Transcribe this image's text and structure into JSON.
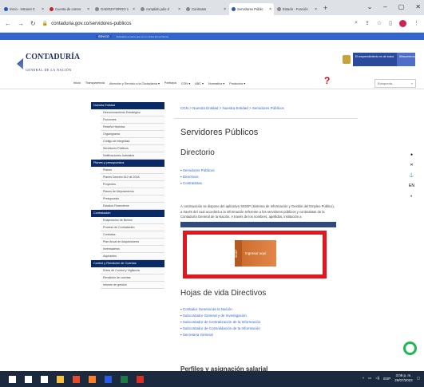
{
  "browser": {
    "tabs": [
      {
        "label": "Inicio - Intranet C",
        "fav": "#2a55b0",
        "active": false
      },
      {
        "label": "Cuenta de correo",
        "fav": "#c5221f",
        "active": false
      },
      {
        "label": "GADOZ-FORGO 1",
        "fav": "#888888",
        "active": false
      },
      {
        "label": "cumplido julio d",
        "fav": "#888888",
        "active": false
      },
      {
        "label": "Contratos",
        "fav": "#888888",
        "active": false
      },
      {
        "label": "Servidores Públic",
        "fav": "#2a55b0",
        "active": true
      },
      {
        "label": "Estado - Función",
        "fav": "#888888",
        "active": false
      }
    ],
    "url": "contaduria.gov.co/servidores-publicos",
    "colors": {
      "tabbar": "#dee1e6"
    }
  },
  "gov_bar": {
    "logo": "GOV.CO",
    "text": "El Estado se tiene que ver en todos los territorios"
  },
  "header": {
    "logo_main": "CONTADURÍA",
    "logo_sub": "GENERAL DE LA NACIÓN",
    "banner_1": "El emprendimiento es de todos",
    "banner_2": "Mincomercio"
  },
  "nav": {
    "items": [
      "Inicio",
      "Transparencia",
      "Atención y Servicio a la Ciudadanía ▾",
      "Participa",
      "CGN ▾",
      "ABC ▾",
      "Normativa ▾",
      "Productos ▾"
    ],
    "question_mark": "?",
    "search_placeholder": "Búsqueda..."
  },
  "sidebar": {
    "sections": [
      {
        "title": "Nuestra Entidad",
        "items": [
          "Direccionamiento Estratégico",
          "Funciones",
          "Reseña Histórica",
          "Organigrama",
          "Código de Integridad",
          "Servidores Públicos",
          "Notificaciones Judiciales"
        ]
      },
      {
        "title": "Planes y presupuestos",
        "items": [
          "Planes",
          "Planes Decreto 612 de 2018",
          "Proyectos",
          "Planes de Mejoramiento",
          "Presupuesto",
          "Estados Financieros"
        ]
      },
      {
        "title": "Contratación",
        "items": [
          "Enajenación de Bienes",
          "Proceso de Contratación",
          "Contratos",
          "Plan Anual de Adquisiciones",
          "Invernaderos",
          "Aspirantes"
        ]
      },
      {
        "title": "Control y Rendición de Cuentas",
        "items": [
          "Entes de Control y Vigilancia",
          "Rendición de cuentas",
          "Informe de gestión"
        ]
      }
    ]
  },
  "content": {
    "breadcrumb": "CGN  >  Nuestra Entidad  >  Nuestra Entidad  >  Servidores Públicos",
    "title": "Servidores Públicos",
    "directorio_title": "Directorio",
    "directorio_links": [
      "Servidores Públicos",
      "Directivos",
      "Contratistas"
    ],
    "paragraph": "A continuación se dispone del aplicativo SIGEP (Sistema de Información y Gestión del Empleo Público), a través del cual accederá a la información referente a los servidores públicos y contratistas de la Contaduría General de la Nación. A través de los nombres, apellidos, institución a",
    "sigep_side": "SIGEP",
    "sigep_button": "Ingresar aquí",
    "hojas_title": "Hojas de vida Directivos",
    "hojas_links": [
      "Contador General de la Nación",
      "Subcontador General y de Investigación",
      "Subcontador de Centralización de la Información",
      "Subcontador de Consolidación de la Información",
      "Secretaria General"
    ],
    "next_title": "Perfiles y asignación salarial"
  },
  "right_rail": [
    "●",
    "✕",
    "⚓",
    "EN",
    "◐"
  ],
  "taskbar": {
    "icons": [
      {
        "name": "windows",
        "color": "#ffffff"
      },
      {
        "name": "search",
        "color": "#ffffff"
      },
      {
        "name": "taskview",
        "color": "#ffffff"
      },
      {
        "name": "explorer",
        "color": "#f6c23e"
      },
      {
        "name": "chrome",
        "color": "#e44b2a"
      },
      {
        "name": "firefox",
        "color": "#ff7f24"
      },
      {
        "name": "word",
        "color": "#2b5ae6"
      },
      {
        "name": "excel",
        "color": "#1d7a45"
      },
      {
        "name": "acrobat",
        "color": "#d93025"
      }
    ],
    "tray_lang": "ESP",
    "time": "3:09 p. m.",
    "date": "26/07/2022"
  }
}
